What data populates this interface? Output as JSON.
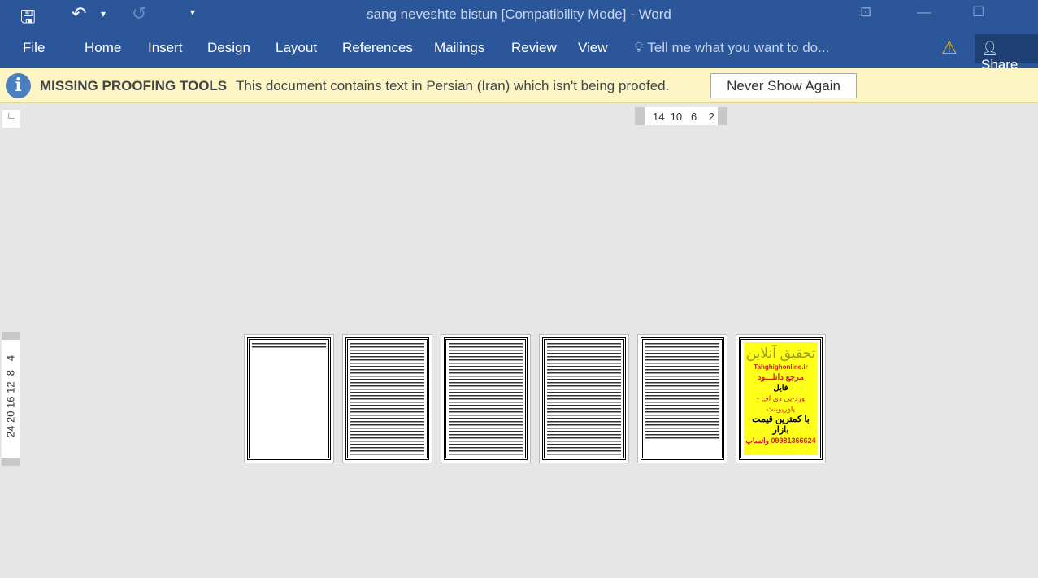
{
  "title": "sang neveshte bistun [Compatibility Mode] - Word",
  "quick_access": {
    "save": "save-icon",
    "undo": "undo-icon",
    "redo": "redo-icon",
    "customize": "▾"
  },
  "tabs": [
    "File",
    "Home",
    "Insert",
    "Design",
    "Layout",
    "References",
    "Mailings",
    "Review",
    "View"
  ],
  "tell_me": "Tell me what you want to do...",
  "share": "Share",
  "message_bar": {
    "title": "MISSING PROOFING TOOLS",
    "text": "This document contains text in Persian (Iran) which isn't being proofed.",
    "button": "Never Show Again"
  },
  "hruler": "14  10   6    2",
  "vruler": "24 20 16 12  8   4",
  "ad": {
    "line1": "تحقیق آنلاین",
    "site": "Tahghighonline.ir",
    "line2": "مرجع دانلـــود",
    "line3": "فایل",
    "line4": "ورد-پی دی اف - پاورپوینت",
    "line5": "با کمترین قیمت بازار",
    "phone": "09981366624 واتساپ"
  },
  "colors": {
    "ribbon": "#2b579a",
    "message_bar": "#fdf6c4",
    "ad_background": "#ffff1a"
  }
}
